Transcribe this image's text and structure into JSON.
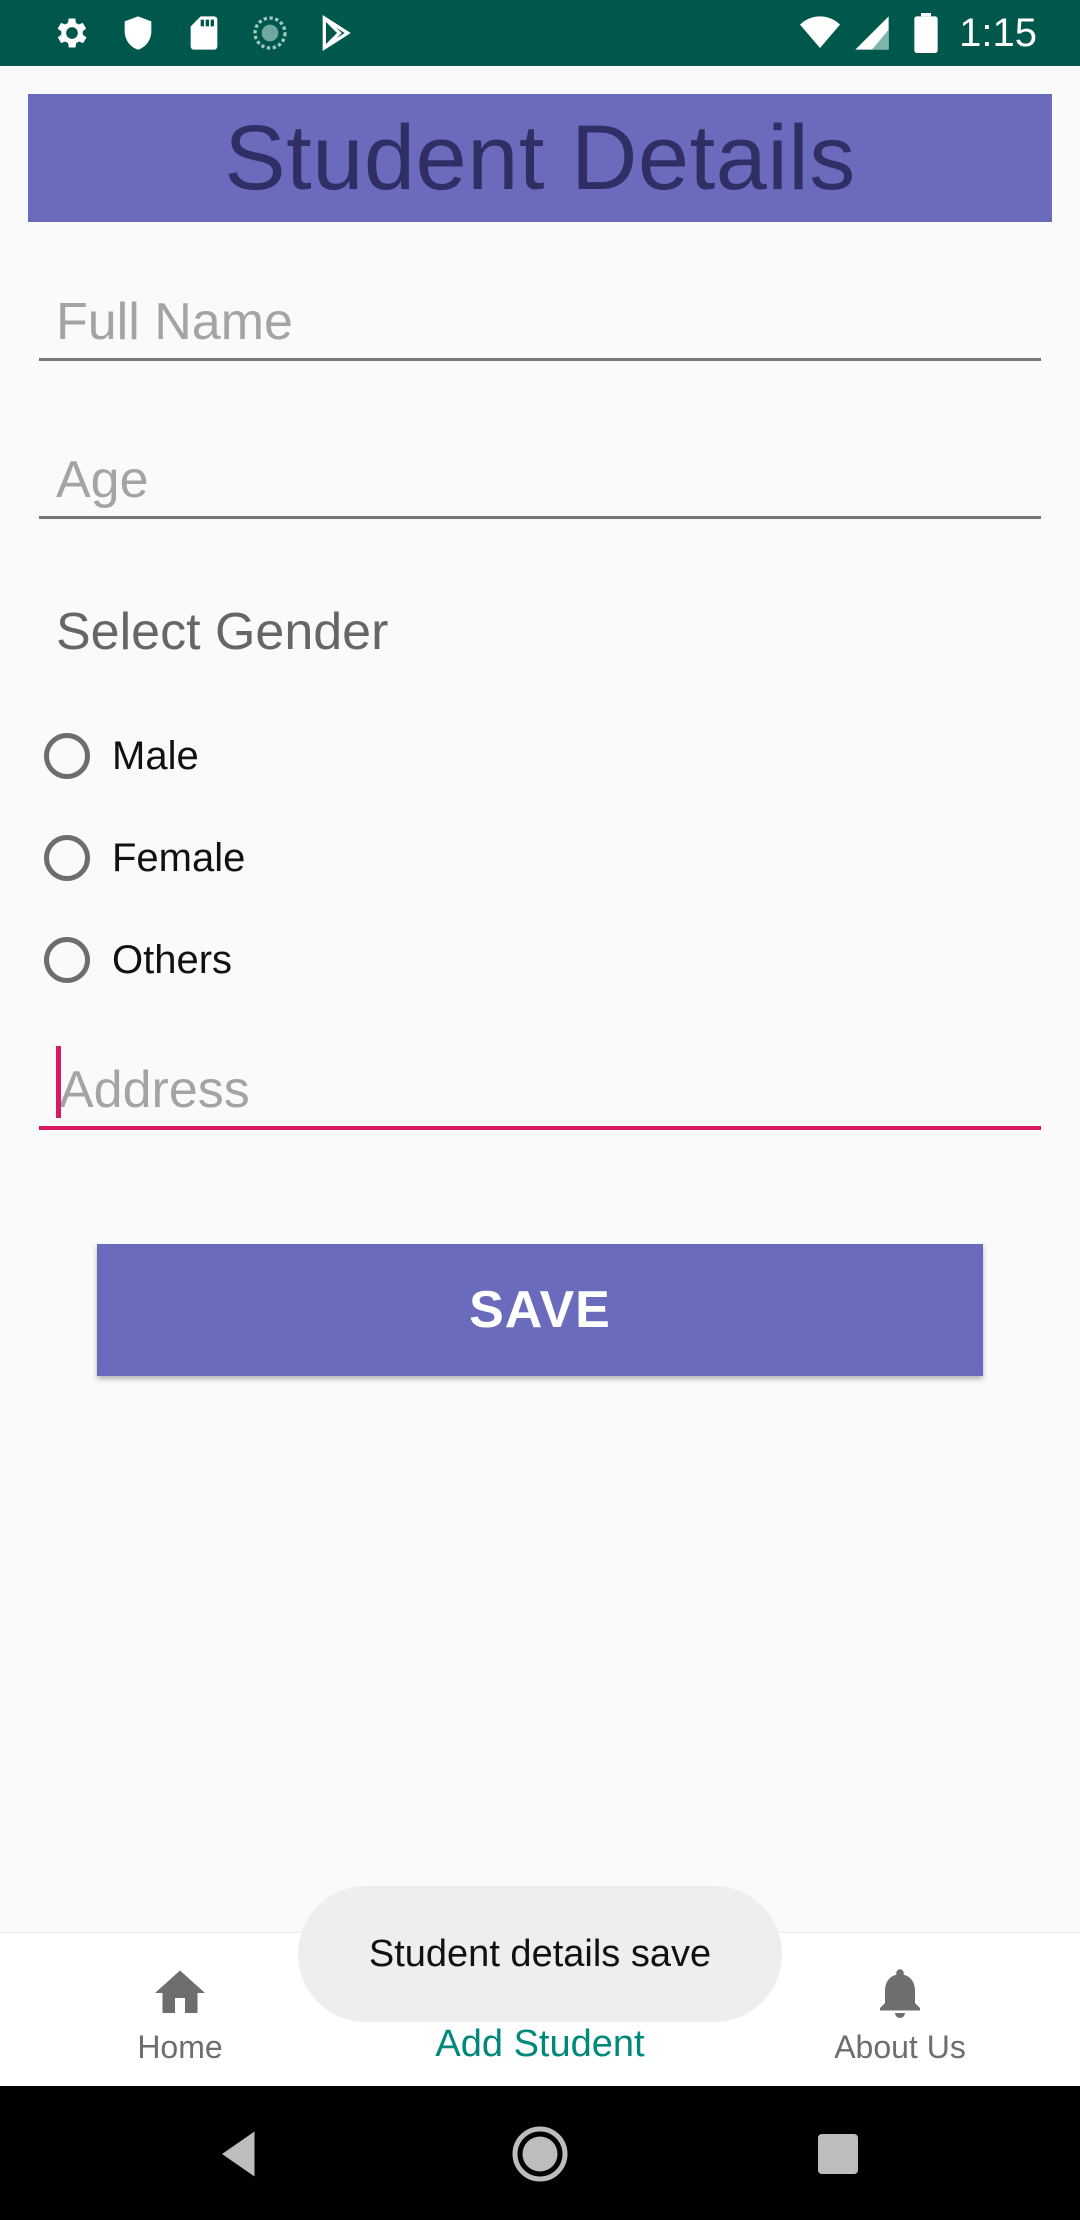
{
  "status_bar": {
    "time": "1:15",
    "icons": [
      "settings-icon",
      "shield-icon",
      "sd-card-icon",
      "sync-icon",
      "play-store-icon",
      "wifi-icon",
      "signal-icon",
      "battery-icon"
    ]
  },
  "title": "Student Details",
  "form": {
    "full_name_placeholder": "Full Name",
    "age_placeholder": "Age",
    "gender_label": "Select Gender",
    "gender_options": [
      "Male",
      "Female",
      "Others"
    ],
    "address_placeholder": "Address",
    "save_label": "SAVE"
  },
  "bottom_nav": {
    "items": [
      {
        "label": "Home",
        "icon": "home-icon",
        "active": false
      },
      {
        "label": "Add Student",
        "icon": "add-person-icon",
        "active": true
      },
      {
        "label": "About Us",
        "icon": "bell-icon",
        "active": false
      }
    ]
  },
  "toast": "Student details save",
  "colors": {
    "status_bar": "#00574b",
    "primary": "#6b6bbd",
    "accent": "#d81b60",
    "nav_active": "#00897b"
  }
}
